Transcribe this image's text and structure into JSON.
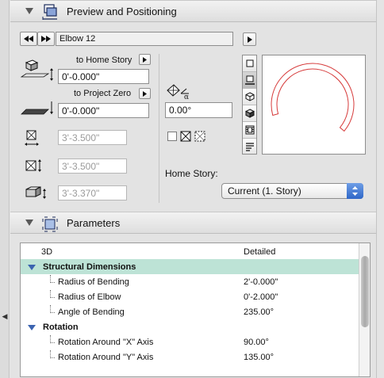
{
  "preview_section": {
    "title": "Preview and Positioning",
    "icon": "3d-box-placement-icon"
  },
  "element_nav": {
    "prev_icon": "rewind-icon",
    "next_icon": "fast-forward-icon",
    "element_name": "Elbow 12",
    "expand_icon": "play-right-icon"
  },
  "elevation": {
    "home_story_label": "to Home Story",
    "home_story_value": "0'-0.000\"",
    "project_zero_label": "to Project Zero",
    "project_zero_value": "0'-0.000\"",
    "width_value": "3'-3.500\"",
    "length_value": "3'-3.500\"",
    "height_value": "3'-3.370\""
  },
  "rotation": {
    "angle_value": "0.00°"
  },
  "home_story": {
    "label": "Home Story:",
    "selected": "Current (1. Story)"
  },
  "preview_modes": [
    "plan-view-icon",
    "floor-plan-view-icon",
    "axonometry-wireframe-icon",
    "axonometry-shaded-icon",
    "film-frame-icon",
    "list-view-icon"
  ],
  "parameters_section": {
    "title": "Parameters",
    "icon": "parameters-box-icon"
  },
  "params_table": {
    "header_name": "3D",
    "header_value": "Detailed",
    "rows": [
      {
        "kind": "group",
        "label": "Structural Dimensions",
        "value": ""
      },
      {
        "kind": "item",
        "label": "Radius of Bending",
        "value": "2'-0.000\""
      },
      {
        "kind": "item",
        "label": "Radius of Elbow",
        "value": "0'-2.000\""
      },
      {
        "kind": "item",
        "label": "Angle of Bending",
        "value": "235.00°"
      },
      {
        "kind": "group",
        "label": "Rotation",
        "value": ""
      },
      {
        "kind": "item",
        "label": "Rotation Around \"X\" Axis",
        "value": "90.00°"
      },
      {
        "kind": "item",
        "label": "Rotation Around \"Y\" Axis",
        "value": "135.00°"
      }
    ]
  },
  "chart_preview": {
    "arc_color": "#d63a3a",
    "angle_of_bending": 235
  }
}
